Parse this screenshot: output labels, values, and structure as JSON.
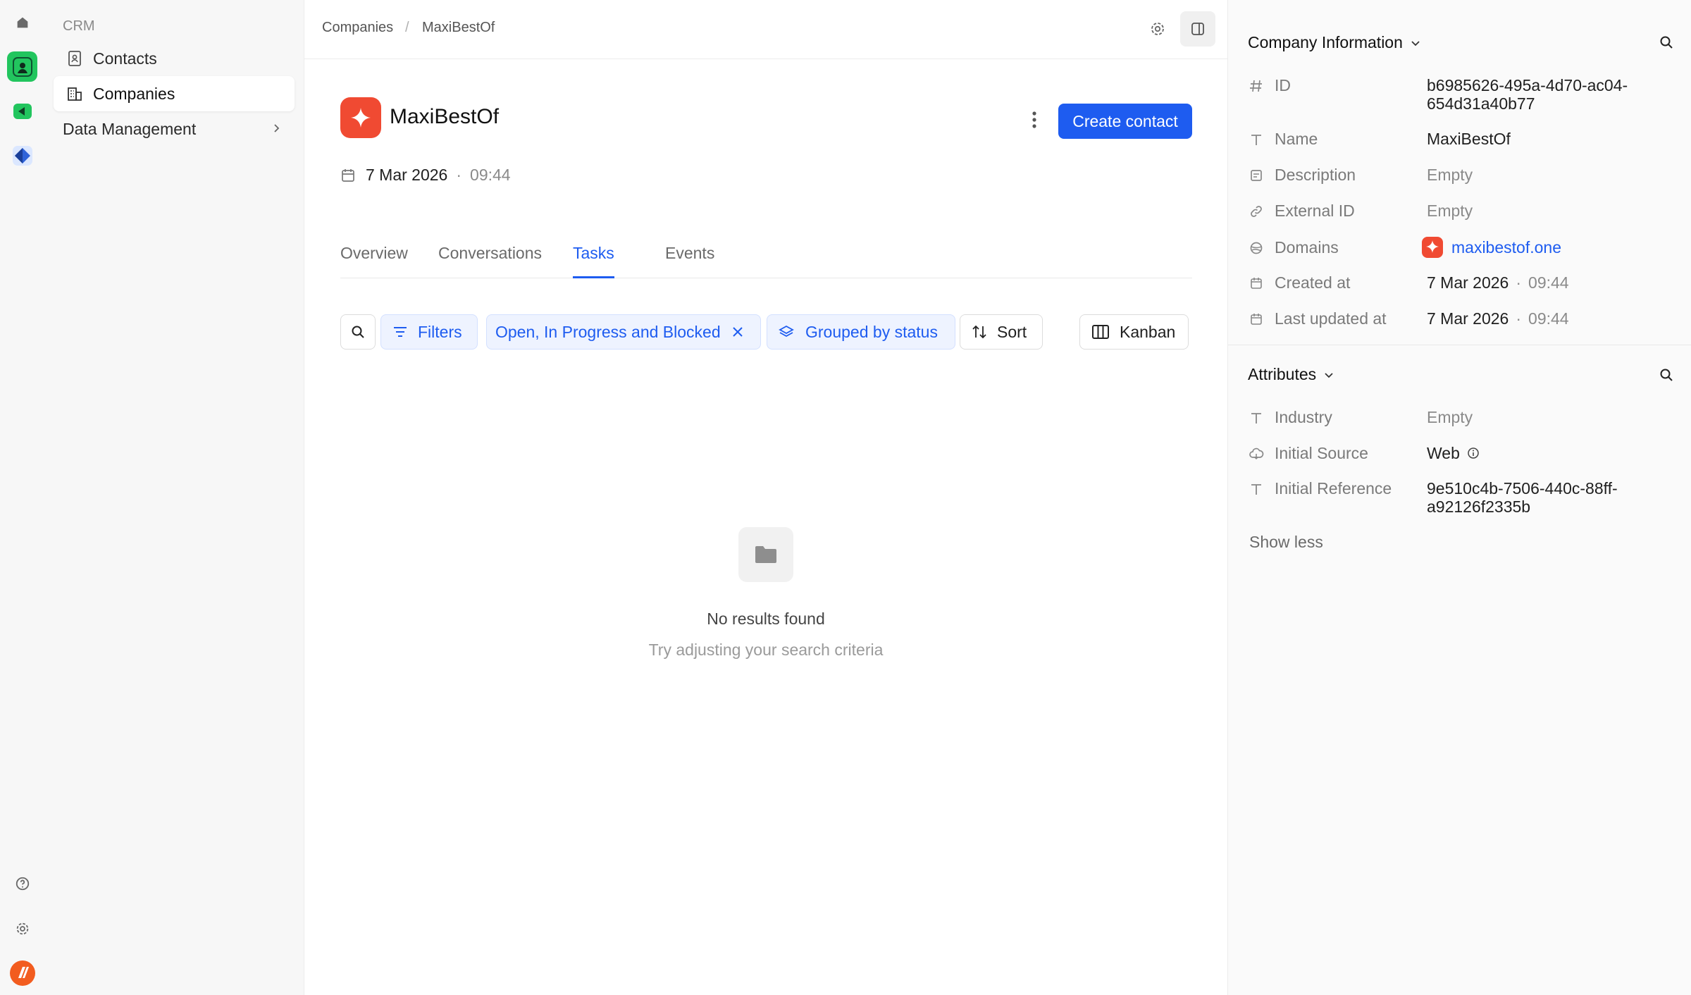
{
  "sidebar": {
    "section": "CRM",
    "items": [
      {
        "label": "Contacts",
        "icon": "contact-book-icon"
      },
      {
        "label": "Companies",
        "icon": "building-icon",
        "active": true
      },
      {
        "label": "Data Management",
        "icon": "chevron-right-icon"
      }
    ]
  },
  "breadcrumb": {
    "parent": "Companies",
    "separator": "/",
    "current": "MaxiBestOf"
  },
  "company": {
    "name": "MaxiBestOf",
    "date": "7 Mar 2026",
    "time": "09:44",
    "primary_action": "Create contact"
  },
  "tabs": [
    {
      "label": "Overview"
    },
    {
      "label": "Conversations"
    },
    {
      "label": "Tasks",
      "active": true
    },
    {
      "label": "Events"
    }
  ],
  "toolbar": {
    "filters": "Filters",
    "filter_chip": "Open, In Progress and Blocked",
    "group_chip": "Grouped by status",
    "sort": "Sort",
    "view": "Kanban"
  },
  "empty_state": {
    "title": "No results found",
    "subtitle": "Try adjusting your search criteria"
  },
  "company_info": {
    "title": "Company Information",
    "fields": {
      "id": {
        "label": "ID",
        "value_line1": "b6985626-495a-4d70-ac04-",
        "value_line2": "654d31a40b77"
      },
      "name": {
        "label": "Name",
        "value": "MaxiBestOf"
      },
      "description": {
        "label": "Description",
        "value": "Empty"
      },
      "external_id": {
        "label": "External ID",
        "value": "Empty"
      },
      "domains": {
        "label": "Domains",
        "value": "maxibestof.one"
      },
      "created_at": {
        "label": "Created at",
        "date": "7 Mar 2026",
        "time": "09:44"
      },
      "last_updated_at": {
        "label": "Last updated at",
        "date": "7 Mar 2026",
        "time": "09:44"
      }
    }
  },
  "attributes": {
    "title": "Attributes",
    "fields": {
      "industry": {
        "label": "Industry",
        "value": "Empty"
      },
      "initial_source": {
        "label": "Initial Source",
        "value": "Web"
      },
      "initial_reference": {
        "label": "Initial Reference",
        "value_line1": "9e510c4b-7506-440c-88ff-",
        "value_line2": "a92126f2335b"
      }
    },
    "toggle": "Show less"
  },
  "colors": {
    "accent": "#1e5cf0",
    "brand": "#f04a32"
  }
}
